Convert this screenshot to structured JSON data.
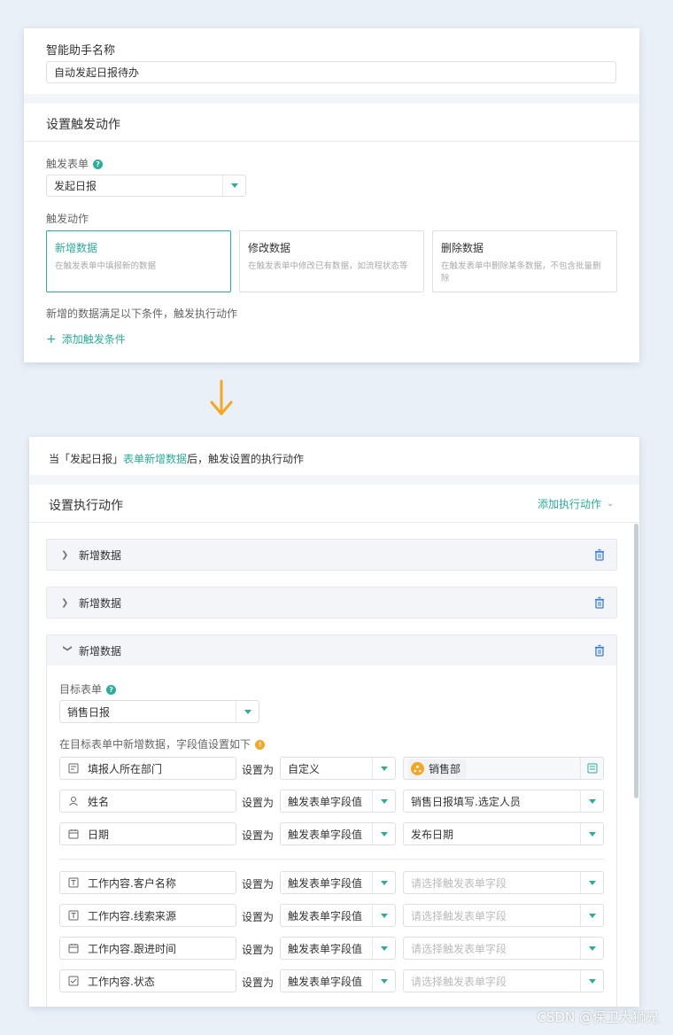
{
  "colors": {
    "accent": "#2bad9a",
    "warning": "#f5a623",
    "background": "#e9f0f8"
  },
  "top": {
    "assistant_name_label": "智能助手名称",
    "assistant_name_value": "自动发起日报待办",
    "trigger_section_title": "设置触发动作",
    "trigger_form_label": "触发表单",
    "trigger_form_value": "发起日报",
    "trigger_action_label": "触发动作",
    "options": [
      {
        "title": "新增数据",
        "desc": "在触发表单中填报新的数据",
        "selected": true
      },
      {
        "title": "修改数据",
        "desc": "在触发表单中修改已有数据，如流程状态等",
        "selected": false
      },
      {
        "title": "删除数据",
        "desc": "在触发表单中删除某条数据，不包含批量删除",
        "selected": false
      }
    ],
    "condition_text": "新增的数据满足以下条件，触发执行动作",
    "add_condition_label": "添加触发条件"
  },
  "bottom": {
    "header_prefix": "当「发起日报」",
    "header_link": "表单新增数据",
    "header_suffix": "后，触发设置的执行动作",
    "action_section_title": "设置执行动作",
    "add_action_label": "添加执行动作",
    "accordions": [
      {
        "title": "新增数据",
        "expanded": false
      },
      {
        "title": "新增数据",
        "expanded": false
      },
      {
        "title": "新增数据",
        "expanded": true
      }
    ],
    "target_form_label": "目标表单",
    "target_form_value": "销售日报",
    "field_hint": "在目标表单中新增数据，字段值设置如下",
    "set_as_label": "设置为",
    "rows": [
      {
        "field": "填报人所在部门",
        "icon": "department-icon",
        "mode": "自定义",
        "value": "销售部",
        "value_type": "tag"
      },
      {
        "field": "姓名",
        "icon": "user-icon",
        "mode": "触发表单字段值",
        "value": "销售日报填写.选定人员",
        "value_type": "select"
      },
      {
        "field": "日期",
        "icon": "calendar-icon",
        "mode": "触发表单字段值",
        "value": "发布日期",
        "value_type": "select"
      },
      {
        "field": "工作内容.客户名称",
        "icon": "text-icon",
        "mode": "触发表单字段值",
        "value": "请选择触发表单字段",
        "value_type": "placeholder"
      },
      {
        "field": "工作内容.线索来源",
        "icon": "text-icon",
        "mode": "触发表单字段值",
        "value": "请选择触发表单字段",
        "value_type": "placeholder"
      },
      {
        "field": "工作内容.跟进时间",
        "icon": "calendar-icon",
        "mode": "触发表单字段值",
        "value": "请选择触发表单字段",
        "value_type": "placeholder"
      },
      {
        "field": "工作内容.状态",
        "icon": "checkbox-icon",
        "mode": "触发表单字段值",
        "value": "请选择触发表单字段",
        "value_type": "placeholder"
      }
    ]
  },
  "watermark": "CSDN @保卫大狮兄"
}
